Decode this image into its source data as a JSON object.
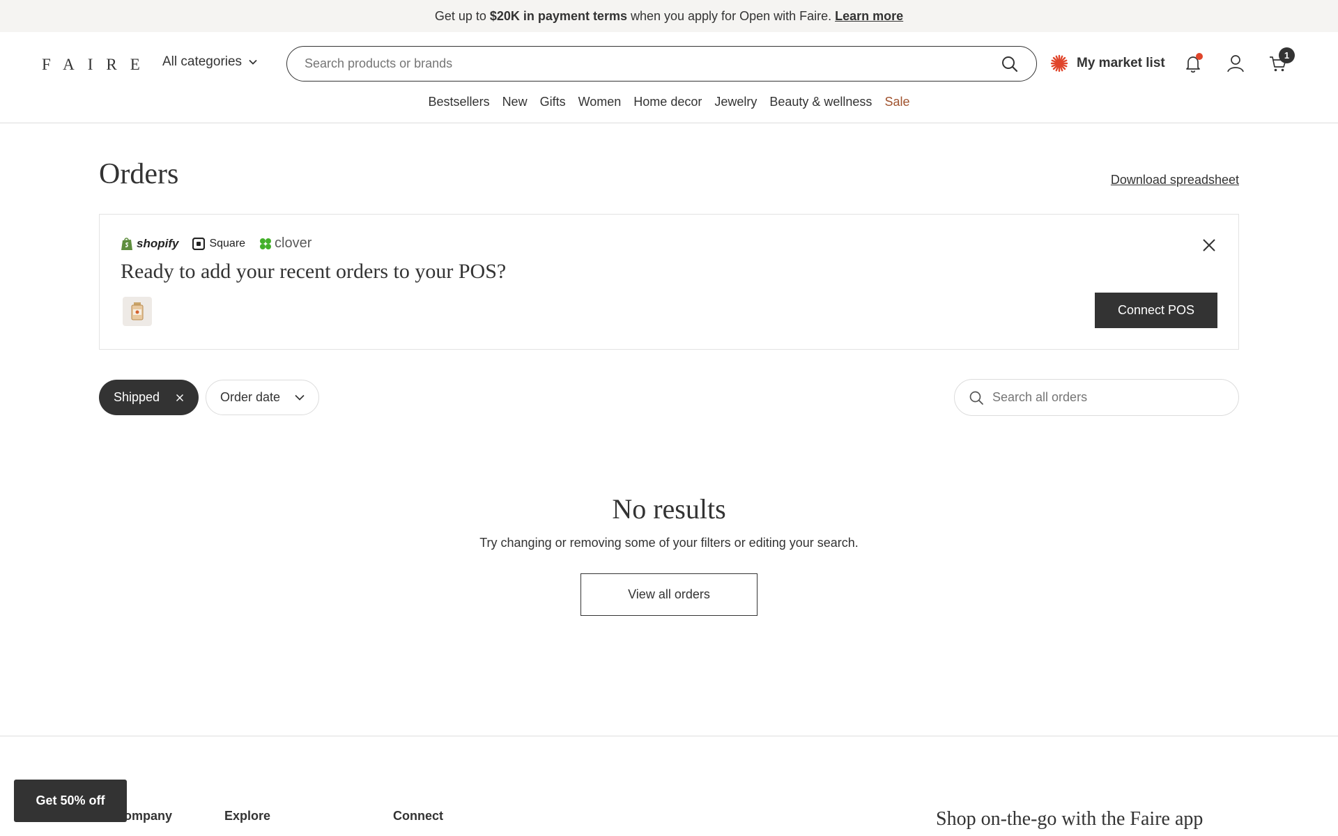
{
  "promo": {
    "prefix": "Get up to",
    "highlight": "$20K in payment terms",
    "suffix": "when you apply for Open with Faire.",
    "link": "Learn more"
  },
  "header": {
    "logo": "FAIRE",
    "categories_label": "All categories",
    "search_placeholder": "Search products or brands",
    "market_list_label": "My market list",
    "cart_count": "1"
  },
  "nav": [
    {
      "label": "Bestsellers"
    },
    {
      "label": "New"
    },
    {
      "label": "Gifts"
    },
    {
      "label": "Women"
    },
    {
      "label": "Home decor"
    },
    {
      "label": "Jewelry"
    },
    {
      "label": "Beauty & wellness"
    },
    {
      "label": "Sale"
    }
  ],
  "page": {
    "title": "Orders",
    "download_label": "Download spreadsheet"
  },
  "pos_banner": {
    "logos": {
      "shopify": "shopify",
      "square": "Square",
      "clover": "clover"
    },
    "question": "Ready to add your recent orders to your POS?",
    "connect_label": "Connect POS"
  },
  "filters": {
    "shipped_label": "Shipped",
    "order_date_label": "Order date",
    "search_placeholder": "Search all orders"
  },
  "empty_state": {
    "title": "No results",
    "message": "Try changing or removing some of your filters or editing your search.",
    "button_label": "View all orders"
  },
  "footer": {
    "columns": [
      {
        "title": "Company"
      },
      {
        "title": "Explore"
      },
      {
        "title": "Connect"
      }
    ],
    "app_text": "Shop on-the-go with the Faire app"
  },
  "floating": {
    "offer_label": "Get 50% off"
  },
  "colors": {
    "accent_dark": "#333333",
    "sale": "#a0522d",
    "notification_dot": "#e0452b",
    "market_icon": "#e0452b",
    "promo_bg": "#f5f4f2"
  }
}
